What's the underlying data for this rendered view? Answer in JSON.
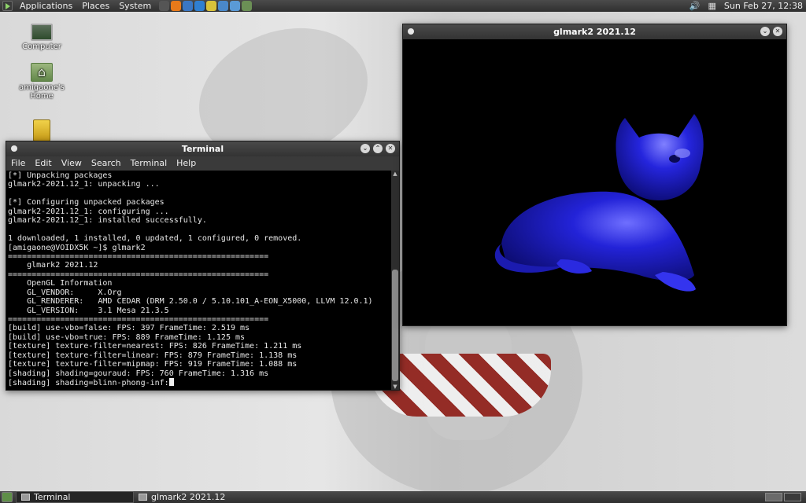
{
  "top_panel": {
    "menus": [
      "Applications",
      "Places",
      "System"
    ],
    "launchers": [
      {
        "icon": "terminal-launcher-icon",
        "color": "#555555"
      },
      {
        "icon": "vlc-icon",
        "color": "#e87a1a"
      },
      {
        "icon": "network-icon",
        "color": "#3a77c4"
      },
      {
        "icon": "web-browser-icon",
        "color": "#2f7fd1"
      },
      {
        "icon": "notes-icon",
        "color": "#d9c23a"
      },
      {
        "icon": "email-icon",
        "color": "#4a88c9"
      },
      {
        "icon": "chat-icon",
        "color": "#5a9ad6"
      },
      {
        "icon": "image-viewer-icon",
        "color": "#6b8f55"
      }
    ],
    "clock": "Sun Feb 27, 12:38"
  },
  "desktop_icons": [
    {
      "label": "Computer"
    },
    {
      "label": "amigaone's Home"
    }
  ],
  "terminal": {
    "title": "Terminal",
    "menus": [
      "File",
      "Edit",
      "View",
      "Search",
      "Terminal",
      "Help"
    ],
    "lines": [
      "[*] Unpacking packages",
      "glmark2-2021.12_1: unpacking ...",
      "",
      "[*] Configuring unpacked packages",
      "glmark2-2021.12_1: configuring ...",
      "glmark2-2021.12_1: installed successfully.",
      "",
      "1 downloaded, 1 installed, 0 updated, 1 configured, 0 removed.",
      "[amigaone@VOIDX5K ~]$ glmark2",
      "=======================================================",
      "    glmark2 2021.12",
      "=======================================================",
      "    OpenGL Information",
      "    GL_VENDOR:     X.Org",
      "    GL_RENDERER:   AMD CEDAR (DRM 2.50.0 / 5.10.101_A-EON_X5000, LLVM 12.0.1)",
      "    GL_VERSION:    3.1 Mesa 21.3.5",
      "=======================================================",
      "[build] use-vbo=false: FPS: 397 FrameTime: 2.519 ms",
      "[build] use-vbo=true: FPS: 889 FrameTime: 1.125 ms",
      "[texture] texture-filter=nearest: FPS: 826 FrameTime: 1.211 ms",
      "[texture] texture-filter=linear: FPS: 879 FrameTime: 1.138 ms",
      "[texture] texture-filter=mipmap: FPS: 919 FrameTime: 1.088 ms",
      "[shading] shading=gouraud: FPS: 760 FrameTime: 1.316 ms",
      "[shading] shading=blinn-phong-inf:"
    ]
  },
  "glmark_window": {
    "title": "glmark2 2021.12",
    "model_color": "#1a1ad0"
  },
  "taskbar": {
    "tasks": [
      {
        "label": "Terminal"
      },
      {
        "label": "glmark2 2021.12"
      }
    ]
  }
}
